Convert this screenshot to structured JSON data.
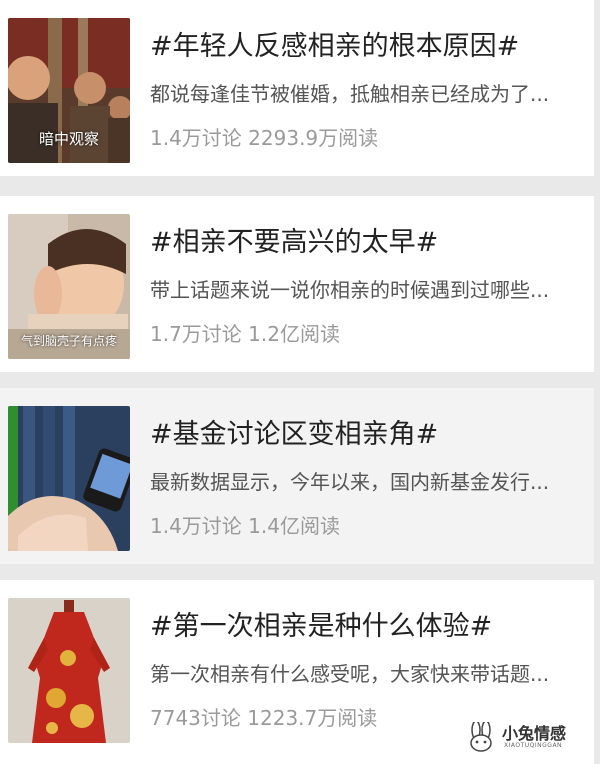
{
  "topics": [
    {
      "title": "#年轻人反感相亲的根本原因#",
      "description": "都说每逢佳节被催婚，抵触相亲已经成为了...",
      "discussions": "1.4万讨论",
      "reads": "2293.9万阅读",
      "thumb_caption": "暗中观察",
      "thumb_icon": "crowd-photo"
    },
    {
      "title": "#相亲不要高兴的太早#",
      "description": "带上话题来说一说你相亲的时候遇到过哪些...",
      "discussions": "1.7万讨论",
      "reads": "1.2亿阅读",
      "thumb_caption": "气到脑壳子有点疼",
      "thumb_icon": "child-sleeping-photo"
    },
    {
      "title": "#基金讨论区变相亲角#",
      "description": "最新数据显示，今年以来，国内新基金发行...",
      "discussions": "1.4万讨论",
      "reads": "1.4亿阅读",
      "thumb_caption": "",
      "thumb_icon": "phone-in-hand-photo"
    },
    {
      "title": "#第一次相亲是种什么体验#",
      "description": "第一次相亲有什么感受呢，大家快来带话题...",
      "discussions": "7743讨论",
      "reads": "1223.7万阅读",
      "thumb_caption": "",
      "thumb_icon": "red-dress-photo"
    }
  ],
  "watermark": {
    "name": "小兔情感",
    "sub": "XIAOTUQINGGAN",
    "icon": "rabbit-logo-icon"
  }
}
